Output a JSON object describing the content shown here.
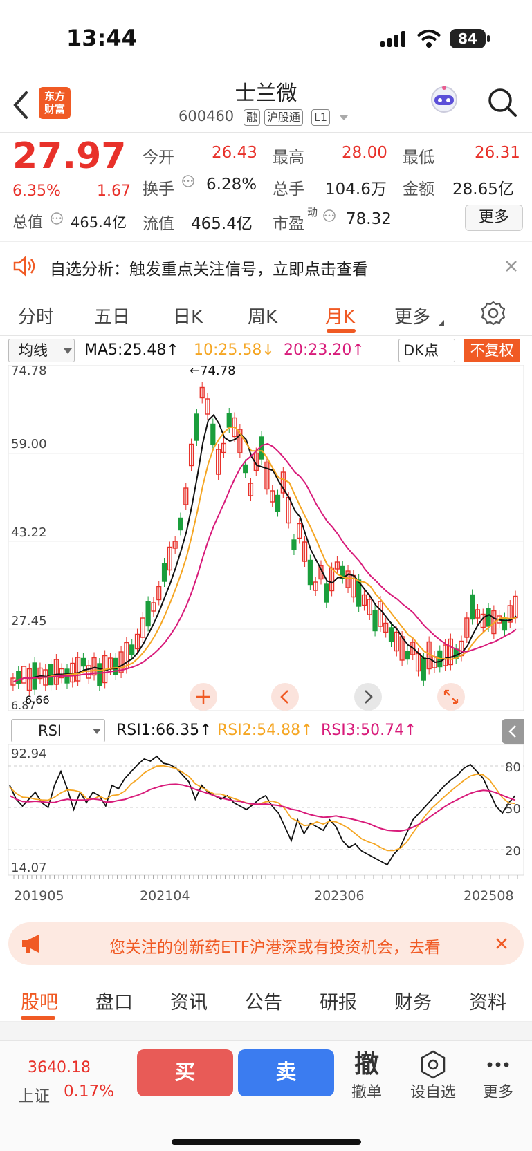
{
  "status_bar": {
    "time": "13:44",
    "battery": "84"
  },
  "header": {
    "logo_line1": "东方",
    "logo_line2": "财富",
    "stock_name": "士兰微",
    "stock_code": "600460",
    "tags": [
      "融",
      "沪股通",
      "L1"
    ]
  },
  "quote": {
    "price": "27.97",
    "change_pct": "6.35%",
    "change_amt": "1.67",
    "open_label": "今开",
    "open": "26.43",
    "high_label": "最高",
    "high": "28.00",
    "low_label": "最低",
    "low": "26.31",
    "turnover_label": "换手",
    "turnover": "6.28%",
    "volume_label": "总手",
    "volume": "104.6万",
    "amount_label": "金额",
    "amount": "28.65亿",
    "mktcap_label": "总值",
    "mktcap": "465.4亿",
    "float_label": "流值",
    "float_cap": "465.4亿",
    "pe_label": "市盈",
    "pe_sup": "动",
    "pe": "78.32",
    "more_button": "更多"
  },
  "notice": {
    "text": "自选分析：触发重点关注信号，立即点击查看"
  },
  "period_tabs": {
    "items": [
      "分时",
      "五日",
      "日K",
      "周K",
      "月K",
      "更多"
    ],
    "active": "月K"
  },
  "kline_toolbar": {
    "indicator_select": "均线",
    "ma5": "MA5:25.48↑",
    "ma10": "10:25.58↓",
    "ma20": "20:23.20↑",
    "dk_button": "DK点",
    "adjust_button": "不复权"
  },
  "kline_chart": {
    "y_labels": [
      "74.78",
      "59.00",
      "43.22",
      "27.45",
      "6.87"
    ],
    "max_label": "←74.78",
    "min_label": "6.66"
  },
  "rsi_toolbar": {
    "indicator_select": "RSI",
    "rsi1": "RSI1:66.35↑",
    "rsi2": "RSI2:54.88↑",
    "rsi3": "RSI3:50.74↑"
  },
  "rsi_chart": {
    "y_top": "92.94",
    "y_bottom": "14.07",
    "right_labels": [
      "80",
      "50",
      "20"
    ],
    "x_labels": [
      "201905",
      "202104",
      "202306",
      "202508"
    ]
  },
  "ad_banner": {
    "text": "您关注的创新药ETF沪港深或有投资机会，去看"
  },
  "bottom_tabs": {
    "items": [
      "股吧",
      "盘口",
      "资讯",
      "公告",
      "研报",
      "财务",
      "资料"
    ],
    "active": "股吧"
  },
  "bottom_bar": {
    "index_value": "3640.18",
    "index_name": "上证",
    "index_change": "0.17%",
    "buy": "买",
    "sell": "卖",
    "cancel_glyph": "撤",
    "cancel_label": "撤单",
    "watch_label": "设自选",
    "more_label": "更多"
  },
  "colors": {
    "up": "#e8312a",
    "down": "#1a9e3c",
    "accent": "#f05a24",
    "ma5": "#111111",
    "ma10": "#f5a623",
    "ma20": "#d81b7a",
    "sell_blue": "#3b7cf0"
  }
}
